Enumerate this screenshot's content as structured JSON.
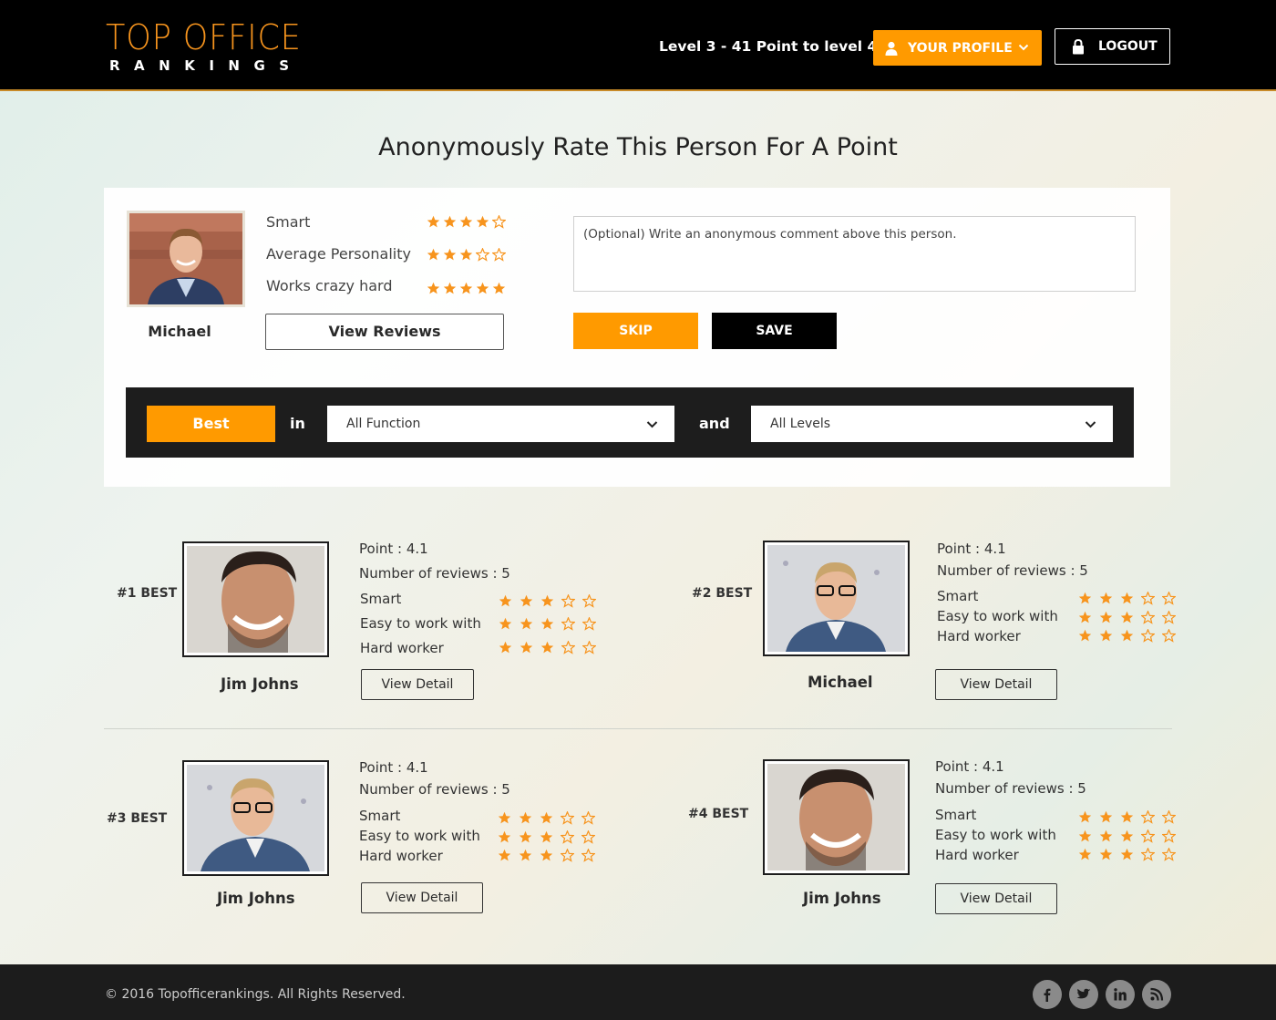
{
  "header": {
    "logo_top": "TOP OFFICE",
    "logo_bottom": "RANKINGS",
    "level_text": "Level 3 - 41 Point to level 4",
    "profile_label": "YOUR PROFILE",
    "logout_label": "LOGOUT"
  },
  "page_title": "Anonymously Rate This Person For A Point",
  "rate_card": {
    "name": "Michael",
    "criteria": [
      {
        "label": "Smart",
        "stars": 4
      },
      {
        "label": "Average Personality",
        "stars": 3
      },
      {
        "label": "Works crazy hard",
        "stars": 5
      }
    ],
    "view_reviews_label": "View Reviews",
    "comment_placeholder": "(Optional) Write an anonymous comment above this person.",
    "skip_label": "SKIP",
    "save_label": "SAVE"
  },
  "filter": {
    "best_label": "Best",
    "in_word": "in",
    "function_value": "All Function",
    "and_word": "and",
    "levels_value": "All Levels"
  },
  "rankings": [
    {
      "rank": "#1 BEST",
      "name": "Jim Johns",
      "point": "Point : 4.1",
      "reviews": "Number of reviews : 5",
      "criteria": [
        {
          "label": "Smart",
          "stars": 3
        },
        {
          "label": "Easy to work with",
          "stars": 3
        },
        {
          "label": "Hard worker",
          "stars": 3
        }
      ],
      "detail_label": "View Detail"
    },
    {
      "rank": "#2 BEST",
      "name": "Michael",
      "point": "Point : 4.1",
      "reviews": "Number of reviews : 5",
      "criteria": [
        {
          "label": "Smart",
          "stars": 3
        },
        {
          "label": "Easy to work with",
          "stars": 3
        },
        {
          "label": "Hard worker",
          "stars": 3
        }
      ],
      "detail_label": "View Detail"
    },
    {
      "rank": "#3 BEST",
      "name": "Jim Johns",
      "point": "Point : 4.1",
      "reviews": "Number of reviews : 5",
      "criteria": [
        {
          "label": "Smart",
          "stars": 3
        },
        {
          "label": "Easy to work with",
          "stars": 3
        },
        {
          "label": "Hard worker",
          "stars": 3
        }
      ],
      "detail_label": "View Detail"
    },
    {
      "rank": "#4 BEST",
      "name": "Jim Johns",
      "point": "Point : 4.1",
      "reviews": "Number of reviews : 5",
      "criteria": [
        {
          "label": "Smart",
          "stars": 3
        },
        {
          "label": "Easy to work with",
          "stars": 3
        },
        {
          "label": "Hard worker",
          "stars": 3
        }
      ],
      "detail_label": "View Detail"
    }
  ],
  "footer": {
    "copyright": "© 2016 Topofficerankings. All Rights Reserved.",
    "social_icons": [
      "facebook-icon",
      "twitter-icon",
      "linkedin-icon",
      "rss-icon"
    ]
  },
  "colors": {
    "accent": "#ff9a00",
    "star": "#f7941d",
    "header_bg": "#000000",
    "filter_bg": "#1d1d1d",
    "footer_bg": "#1c1c1c"
  }
}
